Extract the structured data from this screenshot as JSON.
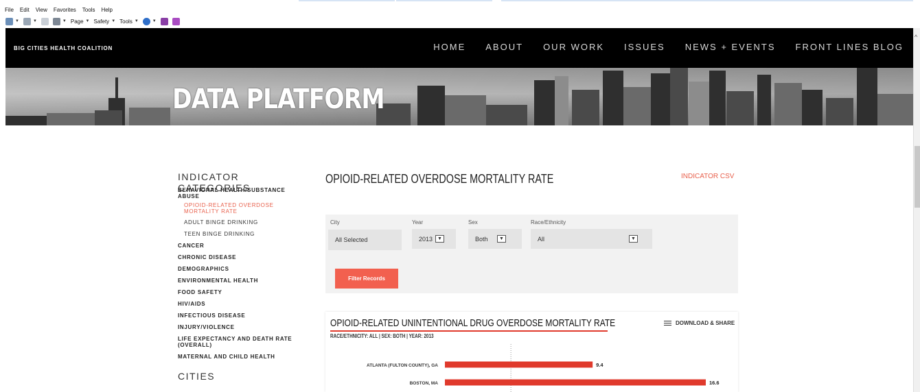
{
  "browser": {
    "menu": [
      "File",
      "Edit",
      "View",
      "Favorites",
      "Tools",
      "Help"
    ],
    "commands": [
      "Page",
      "Safety",
      "Tools"
    ]
  },
  "header": {
    "brand": "BIG CITIES HEALTH COALITION",
    "nav": [
      "HOME",
      "ABOUT",
      "OUR WORK",
      "ISSUES",
      "NEWS + EVENTS",
      "FRONT LINES BLOG"
    ]
  },
  "banner": {
    "title": "DATA PLATFORM"
  },
  "sidebar": {
    "heading": "INDICATOR CATEGORIES",
    "first_category": "BEHAVIORAL HEALTH/SUBSTANCE ABUSE",
    "subitems": [
      "OPIOID-RELATED OVERDOSE MORTALITY RATE",
      "ADULT BINGE DRINKING",
      "TEEN BINGE DRINKING"
    ],
    "categories": [
      "CANCER",
      "CHRONIC DISEASE",
      "DEMOGRAPHICS",
      "ENVIRONMENTAL HEALTH",
      "FOOD SAFETY",
      "HIV/AIDS",
      "INFECTIOUS DISEASE",
      "INJURY/VIOLENCE",
      "LIFE EXPECTANCY AND DEATH RATE (OVERALL)",
      "MATERNAL AND CHILD HEALTH"
    ],
    "cities_heading": "CITIES"
  },
  "main": {
    "title": "OPIOID-RELATED OVERDOSE MORTALITY RATE",
    "csv_link": "INDICATOR CSV"
  },
  "filters": {
    "city": {
      "label": "City",
      "value": "All Selected"
    },
    "year": {
      "label": "Year",
      "value": "2013"
    },
    "sex": {
      "label": "Sex",
      "value": "Both"
    },
    "race": {
      "label": "Race/Ethnicity",
      "value": "All"
    },
    "button": "Filter Records"
  },
  "chart_card": {
    "title": "OPIOID-RELATED UNINTENTIONAL DRUG OVERDOSE MORTALITY RATE",
    "subtitle": "RACE/ETHNICITY: ALL | SEX: BOTH | YEAR: 2013",
    "download": "DOWNLOAD & SHARE"
  },
  "chart_data": {
    "type": "bar",
    "orientation": "horizontal",
    "title": "OPIOID-RELATED UNINTENTIONAL DRUG OVERDOSE MORTALITY RATE",
    "subtitle": "RACE/ETHNICITY: ALL | SEX: BOTH | YEAR: 2013",
    "categories": [
      "ATLANTA (FULTON COUNTY), GA",
      "BOSTON, MA"
    ],
    "values": [
      9.4,
      16.6
    ],
    "value_labels": [
      "9.4",
      "16.6"
    ],
    "xlim": [
      0,
      16.6
    ],
    "reference_line": 4.2,
    "color": "#e03a2c"
  },
  "colors": {
    "accent": "#e8604c",
    "button": "#f2604f",
    "bar": "#e03a2c"
  }
}
